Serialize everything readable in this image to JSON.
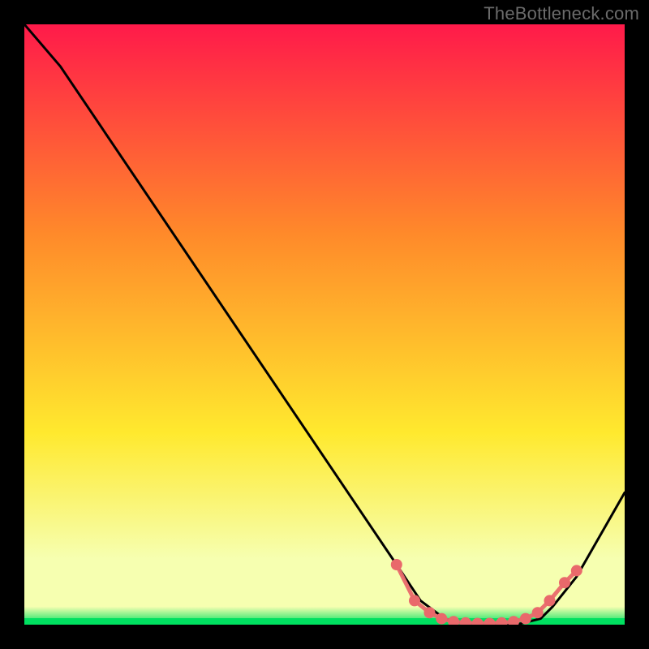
{
  "watermark": "TheBottleneck.com",
  "colors": {
    "bg": "#000000",
    "grad_top": "#ff1a4a",
    "grad_mid1": "#ff8a2a",
    "grad_mid2": "#ffe92e",
    "grad_low": "#f6ffb0",
    "grad_bottom": "#00e060",
    "curve": "#000000",
    "marker": "#e9696b"
  },
  "chart_data": {
    "type": "line",
    "title": "",
    "xlabel": "",
    "ylabel": "",
    "xlim": [
      0,
      100
    ],
    "ylim": [
      0,
      100
    ],
    "series": [
      {
        "name": "curve",
        "x": [
          0,
          6,
          62,
          66,
          70,
          74,
          78,
          82,
          86,
          88,
          92,
          100
        ],
        "values": [
          100,
          93,
          10,
          4,
          1,
          0,
          0,
          0,
          1,
          3,
          8,
          22
        ]
      }
    ],
    "markers": {
      "x": [
        62,
        65,
        67.5,
        69.5,
        71.5,
        73.5,
        75.5,
        77.5,
        79.5,
        81.5,
        83.5,
        85.5,
        87.5,
        90,
        92
      ],
      "values": [
        10,
        4,
        2,
        1,
        0.5,
        0.3,
        0.2,
        0.2,
        0.3,
        0.5,
        1,
        2,
        4,
        7,
        9
      ]
    }
  }
}
